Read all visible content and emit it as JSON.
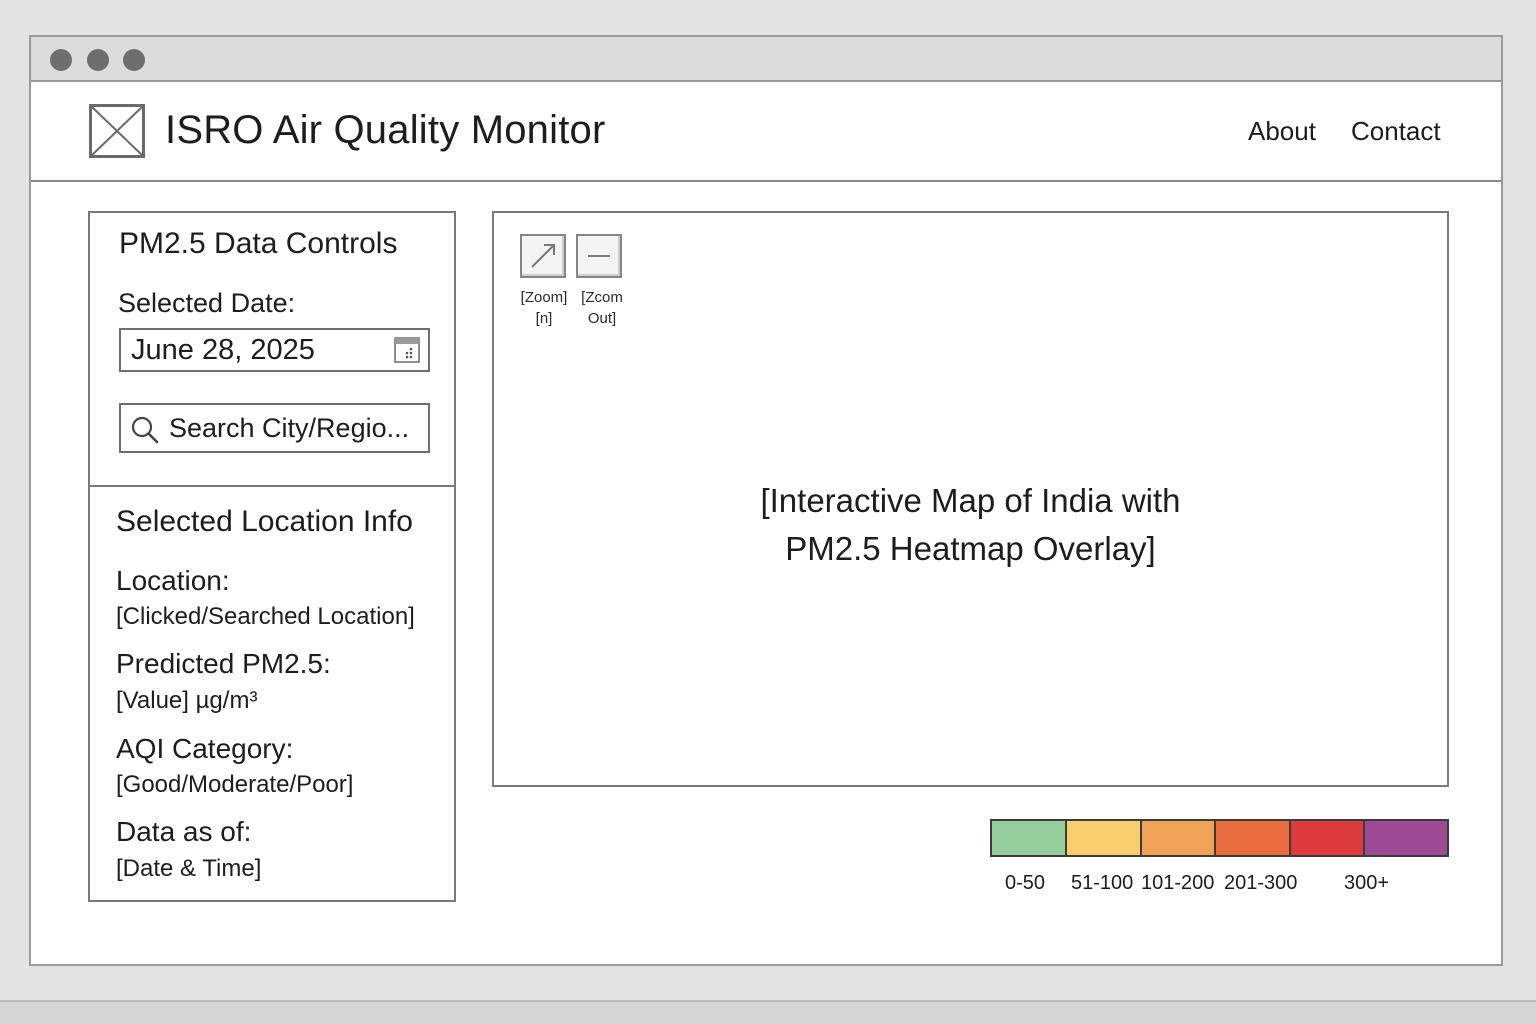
{
  "header": {
    "title": "ISRO Air Quality Monitor",
    "nav": [
      "About",
      "Contact"
    ]
  },
  "controls": {
    "title": "PM2.5 Data Controls",
    "date_label": "Selected Date:",
    "date_value": "June 28, 2025",
    "search_placeholder": "Search City/Regio..."
  },
  "location_info": {
    "title": "Selected Location Info",
    "location_label": "Location:",
    "location_value": "[Clicked/Searched Location]",
    "pm25_label": "Predicted PM2.5:",
    "pm25_value": "[Value] µg/m³",
    "aqi_label": "AQI Category:",
    "aqi_value": "[Good/Moderate/Poor]",
    "asof_label": "Data as of:",
    "asof_value": "[Date & Time]"
  },
  "map": {
    "zoom_in_caption_1": "[Zoom]",
    "zoom_in_caption_2": "[n]",
    "zoom_out_caption_1": "[Zcom",
    "zoom_out_caption_2": "Out]",
    "placeholder_line1": "[Interactive Map of India with",
    "placeholder_line2": "PM2.5 Heatmap Overlay]"
  },
  "legend": {
    "colors": [
      "#96cf9d",
      "#f7cd6d",
      "#f2a257",
      "#e96d3f",
      "#dc3a3c",
      "#9c4a93"
    ],
    "labels": [
      "0-50",
      "51-100",
      "101-200",
      "201-300",
      "300+"
    ]
  },
  "icons": {
    "logo": "image-placeholder-icon",
    "calendar": "calendar-icon",
    "search": "search-icon",
    "zoom_in": "expand-arrow-icon",
    "zoom_out": "minus-icon"
  }
}
